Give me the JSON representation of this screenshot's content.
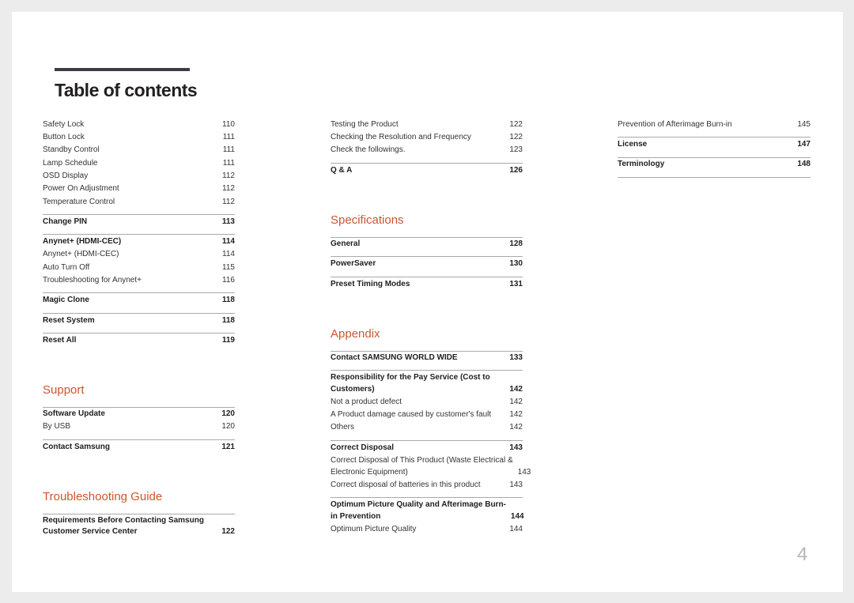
{
  "theme": {
    "accent": "#c8572f"
  },
  "document": {
    "title": "Table of contents",
    "page_number": "4"
  },
  "columns": [
    {
      "items": [
        {
          "type": "entry",
          "lines": [
            "Safety Lock"
          ],
          "page": "110"
        },
        {
          "type": "entry",
          "lines": [
            "Button Lock"
          ],
          "page": "111"
        },
        {
          "type": "entry",
          "lines": [
            "Standby Control"
          ],
          "page": "111"
        },
        {
          "type": "entry",
          "lines": [
            "Lamp Schedule"
          ],
          "page": "111"
        },
        {
          "type": "entry",
          "lines": [
            "OSD Display"
          ],
          "page": "112"
        },
        {
          "type": "entry",
          "lines": [
            "Power On Adjustment"
          ],
          "page": "112"
        },
        {
          "type": "entry",
          "lines": [
            "Temperature Control"
          ],
          "page": "112"
        },
        {
          "type": "rule"
        },
        {
          "type": "section",
          "lines": [
            "Change PIN"
          ],
          "page": "113"
        },
        {
          "type": "rule"
        },
        {
          "type": "section",
          "lines": [
            "Anynet+ (HDMI-CEC)"
          ],
          "page": "114"
        },
        {
          "type": "entry",
          "lines": [
            "Anynet+ (HDMI-CEC)"
          ],
          "page": "114"
        },
        {
          "type": "entry",
          "lines": [
            "Auto Turn Off"
          ],
          "page": "115"
        },
        {
          "type": "entry",
          "lines": [
            "Troubleshooting for Anynet+"
          ],
          "page": "116"
        },
        {
          "type": "rule"
        },
        {
          "type": "section",
          "lines": [
            "Magic Clone"
          ],
          "page": "118"
        },
        {
          "type": "rule"
        },
        {
          "type": "section",
          "lines": [
            "Reset System"
          ],
          "page": "118"
        },
        {
          "type": "rule"
        },
        {
          "type": "section",
          "lines": [
            "Reset All"
          ],
          "page": "119"
        },
        {
          "type": "heading",
          "text": "Support"
        },
        {
          "type": "section",
          "lines": [
            "Software Update"
          ],
          "page": "120"
        },
        {
          "type": "entry",
          "lines": [
            "By USB"
          ],
          "page": "120"
        },
        {
          "type": "rule"
        },
        {
          "type": "section",
          "lines": [
            "Contact Samsung"
          ],
          "page": "121"
        },
        {
          "type": "heading",
          "text": "Troubleshooting Guide"
        },
        {
          "type": "section",
          "lines": [
            "Requirements Before Contacting Samsung",
            "Customer Service Center"
          ],
          "page": "122"
        }
      ]
    },
    {
      "items": [
        {
          "type": "entry",
          "lines": [
            "Testing the Product"
          ],
          "page": "122"
        },
        {
          "type": "entry",
          "lines": [
            "Checking the Resolution and Frequency"
          ],
          "page": "122"
        },
        {
          "type": "entry",
          "lines": [
            "Check the followings."
          ],
          "page": "123"
        },
        {
          "type": "rule"
        },
        {
          "type": "section",
          "lines": [
            "Q & A"
          ],
          "page": "126"
        },
        {
          "type": "heading",
          "text": "Specifications"
        },
        {
          "type": "section",
          "lines": [
            "General"
          ],
          "page": "128"
        },
        {
          "type": "rule"
        },
        {
          "type": "section",
          "lines": [
            "PowerSaver"
          ],
          "page": "130"
        },
        {
          "type": "rule"
        },
        {
          "type": "section",
          "lines": [
            "Preset Timing Modes"
          ],
          "page": "131"
        },
        {
          "type": "heading",
          "text": "Appendix"
        },
        {
          "type": "section",
          "lines": [
            "Contact SAMSUNG WORLD WIDE"
          ],
          "page": "133"
        },
        {
          "type": "rule"
        },
        {
          "type": "section",
          "lines": [
            "Responsibility for the Pay Service (Cost to",
            "Customers)"
          ],
          "page": "142"
        },
        {
          "type": "entry",
          "lines": [
            "Not a product defect"
          ],
          "page": "142"
        },
        {
          "type": "entry",
          "lines": [
            "A Product damage caused by customer's fault"
          ],
          "page": "142"
        },
        {
          "type": "entry",
          "lines": [
            "Others"
          ],
          "page": "142"
        },
        {
          "type": "rule"
        },
        {
          "type": "section",
          "lines": [
            "Correct Disposal"
          ],
          "page": "143"
        },
        {
          "type": "entry",
          "lines": [
            "Correct Disposal of This Product (Waste Electrical &",
            "Electronic Equipment)"
          ],
          "page": "143"
        },
        {
          "type": "entry",
          "lines": [
            "Correct disposal of batteries in this product"
          ],
          "page": "143"
        },
        {
          "type": "rule"
        },
        {
          "type": "section",
          "lines": [
            "Optimum Picture Quality and Afterimage Burn-",
            "in Prevention"
          ],
          "page": "144"
        },
        {
          "type": "entry",
          "lines": [
            "Optimum Picture Quality"
          ],
          "page": "144"
        }
      ]
    },
    {
      "items": [
        {
          "type": "entry",
          "lines": [
            "Prevention of Afterimage Burn-in"
          ],
          "page": "145"
        },
        {
          "type": "rule"
        },
        {
          "type": "section",
          "lines": [
            "License"
          ],
          "page": "147"
        },
        {
          "type": "rule"
        },
        {
          "type": "section",
          "lines": [
            "Terminology"
          ],
          "page": "148"
        },
        {
          "type": "rule"
        }
      ]
    }
  ]
}
